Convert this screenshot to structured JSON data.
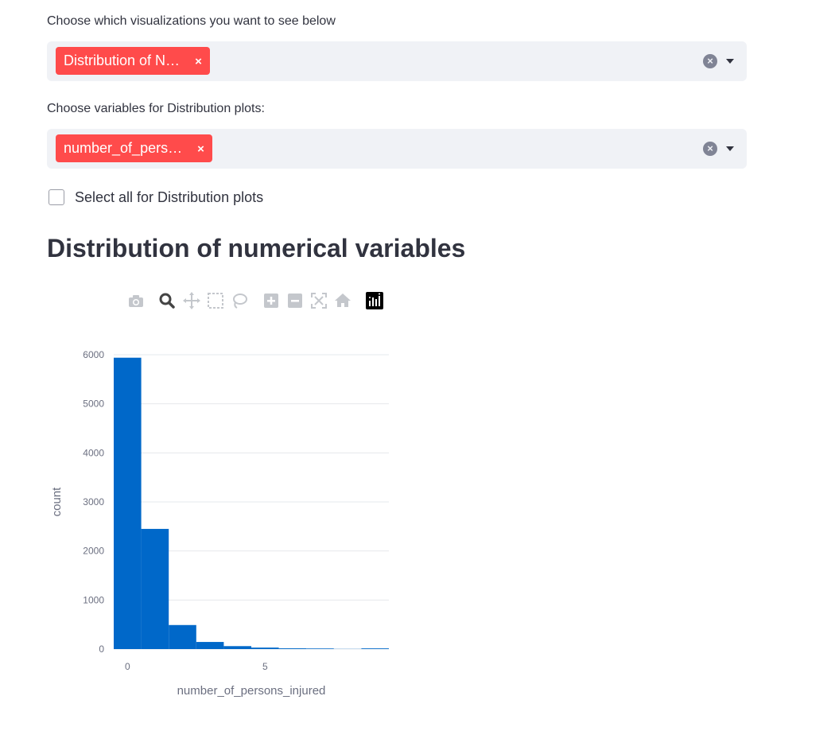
{
  "visualizations_select": {
    "label": "Choose which visualizations you want to see below",
    "selected_tag": "Distribution of N…",
    "tag_remove": "×",
    "clear": "×"
  },
  "variables_select": {
    "label": "Choose variables for Distribution plots:",
    "selected_tag": "number_of_pers…",
    "tag_remove": "×",
    "clear": "×"
  },
  "select_all": {
    "label": "Select all for Distribution plots",
    "checked": false
  },
  "section_heading": "Distribution of numerical variables",
  "modebar_icons": [
    "camera-icon",
    "zoom-icon",
    "pan-icon",
    "box-select-icon",
    "lasso-icon",
    "zoom-in-icon",
    "zoom-out-icon",
    "autoscale-icon",
    "reset-axes-icon",
    "plotly-logo-icon"
  ],
  "colors": {
    "accent": "#ff4b4b",
    "bar": "#0068c9",
    "select_bg": "#f0f2f6"
  },
  "chart_data": {
    "type": "bar",
    "xlabel": "number_of_persons_injured",
    "ylabel": "count",
    "ylim": [
      0,
      6000
    ],
    "xlim": [
      -0.5,
      9.5
    ],
    "yticks": [
      0,
      1000,
      2000,
      3000,
      4000,
      5000,
      6000
    ],
    "xticks": [
      0,
      5
    ],
    "bins": [
      {
        "x": 0,
        "count": 5940
      },
      {
        "x": 1,
        "count": 2450
      },
      {
        "x": 2,
        "count": 490
      },
      {
        "x": 3,
        "count": 145
      },
      {
        "x": 4,
        "count": 60
      },
      {
        "x": 5,
        "count": 30
      },
      {
        "x": 6,
        "count": 15
      },
      {
        "x": 7,
        "count": 12
      },
      {
        "x": 8,
        "count": 3
      },
      {
        "x": 9,
        "count": 14
      }
    ],
    "grid": true
  }
}
